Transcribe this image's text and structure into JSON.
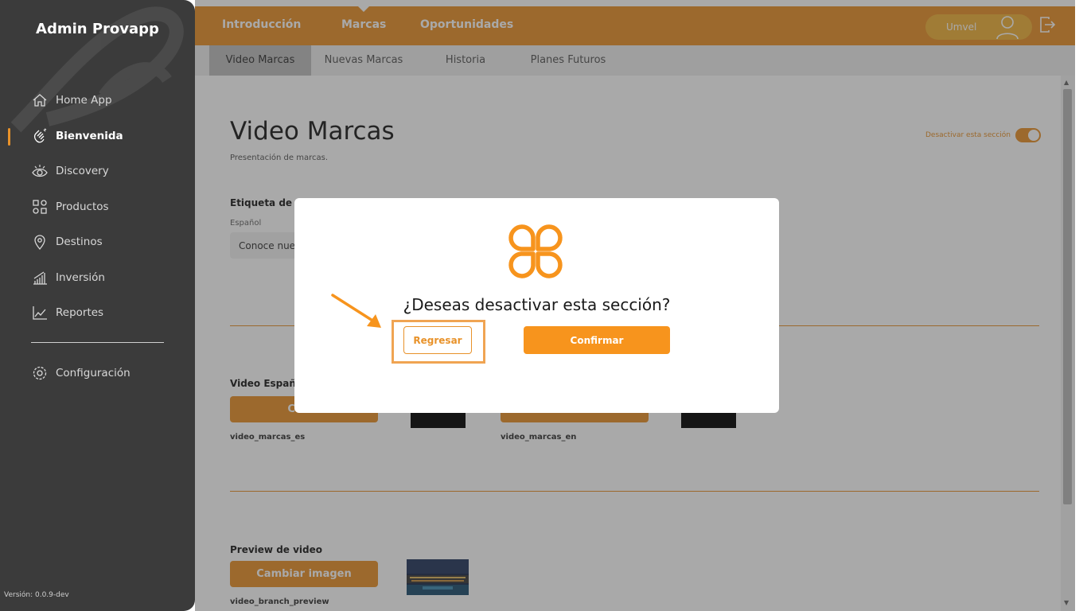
{
  "sidebar": {
    "app_title": "Admin Provapp",
    "items": [
      {
        "label": "Home App",
        "icon": "home-icon"
      },
      {
        "label": "Bienvenida",
        "icon": "hand-wave-icon",
        "active": true
      },
      {
        "label": "Discovery",
        "icon": "eye-icon"
      },
      {
        "label": "Productos",
        "icon": "grid-shapes-icon"
      },
      {
        "label": "Destinos",
        "icon": "location-pin-icon"
      },
      {
        "label": "Inversión",
        "icon": "bar-growth-icon"
      },
      {
        "label": "Reportes",
        "icon": "line-chart-icon"
      }
    ],
    "config": {
      "label": "Configuración",
      "icon": "gear-icon"
    },
    "version": "Versión: 0.0.9-dev"
  },
  "topbar": {
    "tabs": [
      {
        "label": "Introducción"
      },
      {
        "label": "Marcas",
        "active": true
      },
      {
        "label": "Oportunidades"
      }
    ],
    "user": {
      "name": "Umvel"
    }
  },
  "subtabs": [
    {
      "label": "Video Marcas",
      "active": true
    },
    {
      "label": "Nuevas Marcas"
    },
    {
      "label": "Historia"
    },
    {
      "label": "Planes Futuros"
    }
  ],
  "main": {
    "title": "Video Marcas",
    "subtitle": "Presentación de marcas.",
    "toggle_label": "Desactivar esta sección",
    "video_label": {
      "title": "Etiqueta de vi",
      "language": "Español",
      "value": "Conoce nues"
    },
    "video_section": {
      "title": "Video Españo",
      "button_label": "Camb",
      "file_es": "video_marcas_es",
      "file_en": "video_marcas_en"
    },
    "preview": {
      "title": "Preview de video",
      "button_label": "Cambiar imagen",
      "file": "video_branch_preview"
    }
  },
  "modal": {
    "question": "¿Deseas desactivar esta sección?",
    "back_label": "Regresar",
    "confirm_label": "Confirmar"
  },
  "colors": {
    "accent": "#e8922a",
    "sidebar": "#3b3b3b",
    "confirm": "#f7941d"
  }
}
